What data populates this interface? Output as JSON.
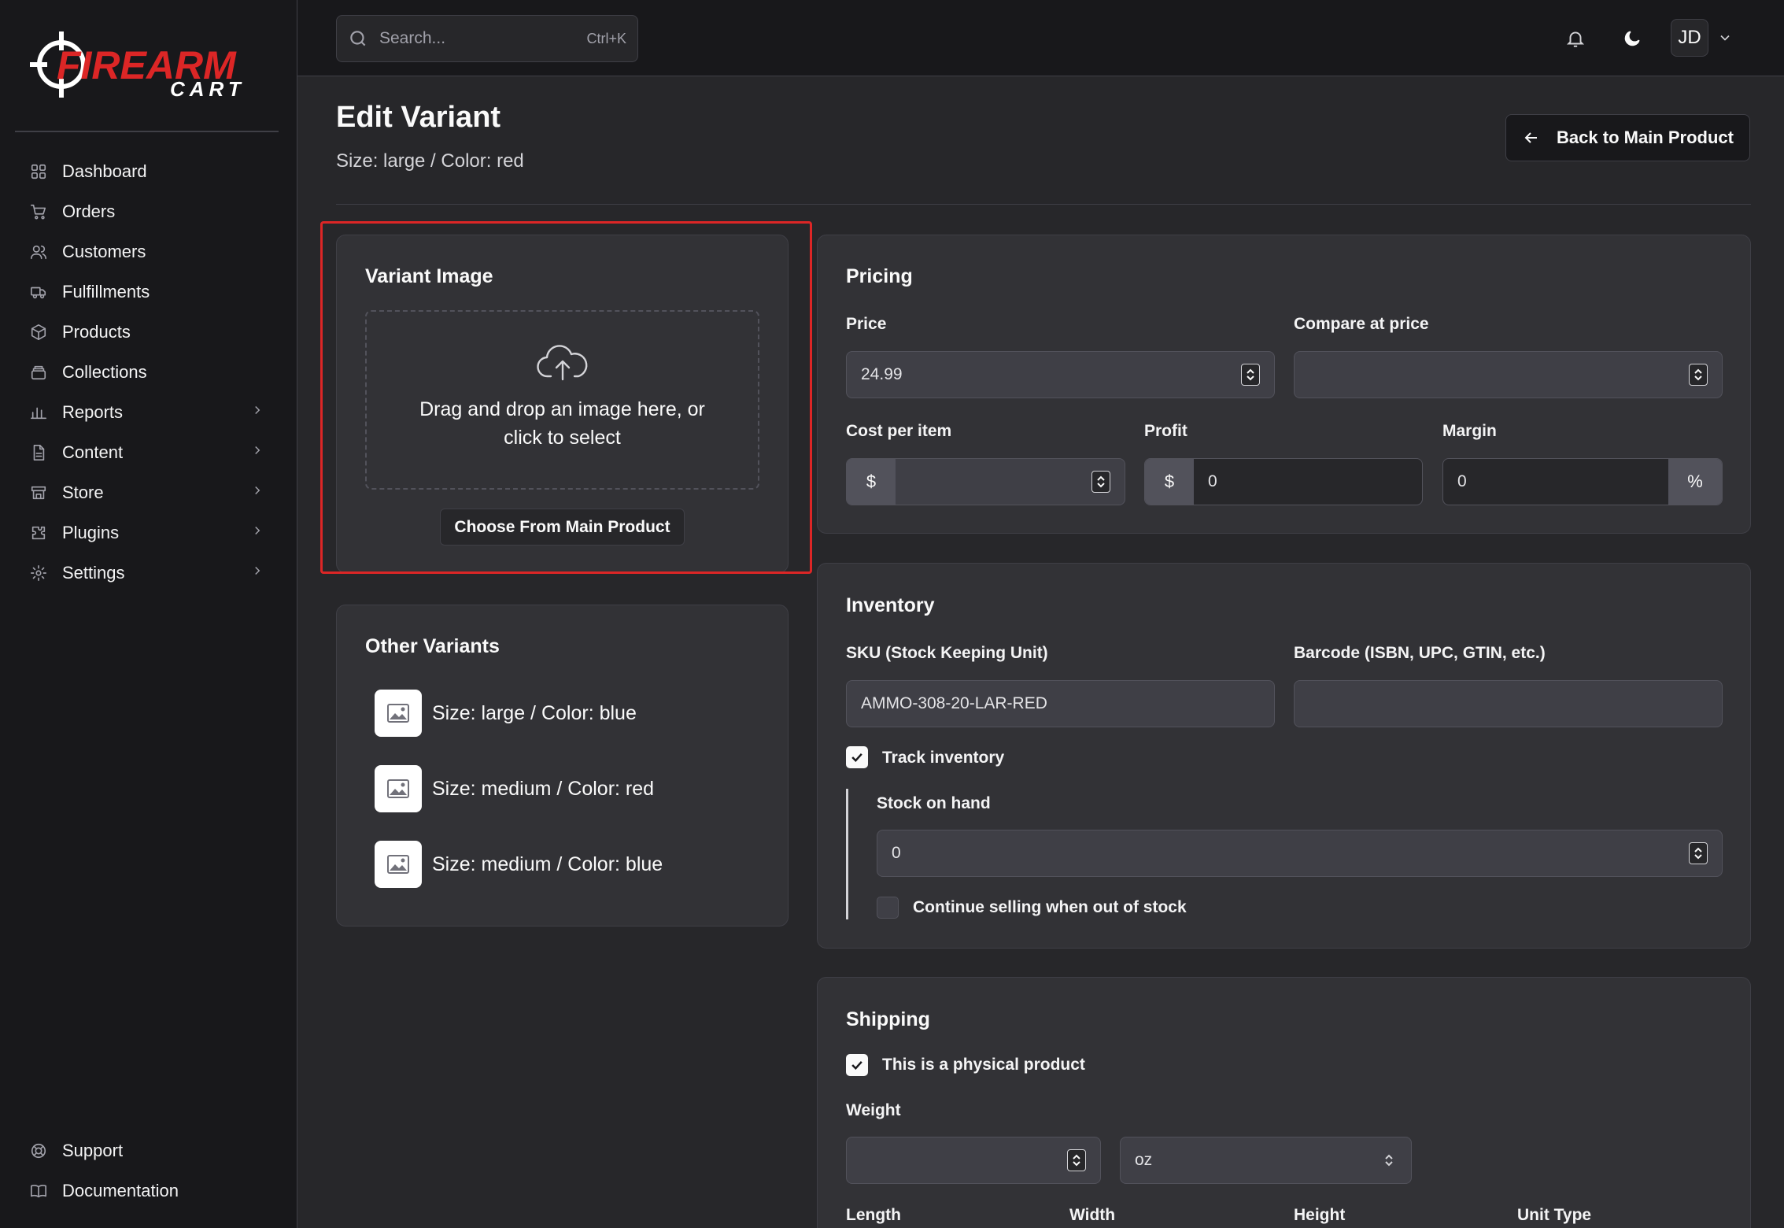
{
  "brand": {
    "logo_text_main": "FIREARM",
    "logo_text_sub": "CART",
    "accent_color": "#dc2626"
  },
  "sidebar": {
    "items": [
      {
        "label": "Dashboard",
        "icon": "grid-icon",
        "has_chevron": false
      },
      {
        "label": "Orders",
        "icon": "cart-icon",
        "has_chevron": false
      },
      {
        "label": "Customers",
        "icon": "users-icon",
        "has_chevron": false
      },
      {
        "label": "Fulfillments",
        "icon": "truck-icon",
        "has_chevron": false
      },
      {
        "label": "Products",
        "icon": "box-icon",
        "has_chevron": false
      },
      {
        "label": "Collections",
        "icon": "layers-icon",
        "has_chevron": false
      },
      {
        "label": "Reports",
        "icon": "bar-chart-icon",
        "has_chevron": true
      },
      {
        "label": "Content",
        "icon": "file-icon",
        "has_chevron": true
      },
      {
        "label": "Store",
        "icon": "store-icon",
        "has_chevron": true
      },
      {
        "label": "Plugins",
        "icon": "puzzle-icon",
        "has_chevron": true
      },
      {
        "label": "Settings",
        "icon": "gear-icon",
        "has_chevron": true
      }
    ],
    "bottom_items": [
      {
        "label": "Support",
        "icon": "lifebuoy-icon"
      },
      {
        "label": "Documentation",
        "icon": "book-icon"
      }
    ]
  },
  "topbar": {
    "search_placeholder": "Search...",
    "search_shortcut": "Ctrl+K",
    "avatar_initials": "JD"
  },
  "header": {
    "title": "Edit Variant",
    "subtitle": "Size: large / Color: red",
    "back_button": "Back to Main Product"
  },
  "variant_image": {
    "title": "Variant Image",
    "dropzone_text": "Drag and drop an image here, or click to select",
    "choose_button": "Choose From Main Product"
  },
  "other_variants": {
    "title": "Other Variants",
    "items": [
      "Size: large / Color: blue",
      "Size: medium / Color: red",
      "Size: medium / Color: blue"
    ]
  },
  "pricing": {
    "title": "Pricing",
    "price_label": "Price",
    "price_value": "24.99",
    "compare_label": "Compare at price",
    "compare_value": "",
    "cost_label": "Cost per item",
    "cost_prefix": "$",
    "cost_value": "",
    "profit_label": "Profit",
    "profit_prefix": "$",
    "profit_value": "0",
    "margin_label": "Margin",
    "margin_value": "0",
    "margin_suffix": "%"
  },
  "inventory": {
    "title": "Inventory",
    "sku_label": "SKU (Stock Keeping Unit)",
    "sku_value": "AMMO-308-20-LAR-RED",
    "barcode_label": "Barcode (ISBN, UPC, GTIN, etc.)",
    "barcode_value": "",
    "track_label": "Track inventory",
    "track_checked": true,
    "stock_label": "Stock on hand",
    "stock_value": "0",
    "continue_label": "Continue selling when out of stock",
    "continue_checked": false
  },
  "shipping": {
    "title": "Shipping",
    "physical_label": "This is a physical product",
    "physical_checked": true,
    "weight_label": "Weight",
    "weight_value": "",
    "weight_unit": "oz",
    "length_label": "Length",
    "width_label": "Width",
    "height_label": "Height",
    "unit_type_label": "Unit Type"
  }
}
